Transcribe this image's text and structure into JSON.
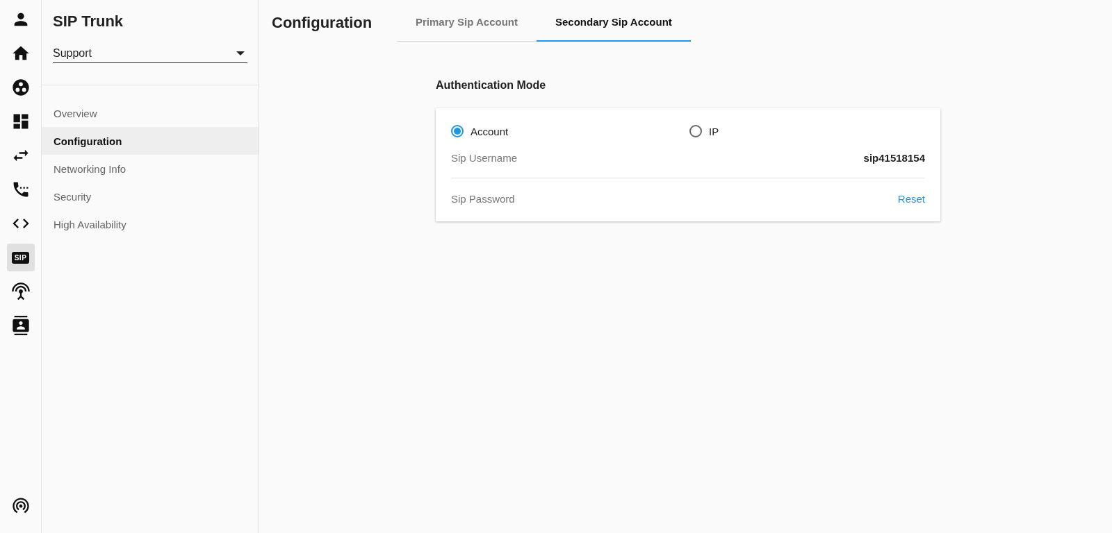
{
  "rail": {
    "items": [
      {
        "kind": "person",
        "selected": false
      },
      {
        "kind": "home",
        "selected": false
      },
      {
        "kind": "circles",
        "selected": false
      },
      {
        "kind": "dashboard",
        "selected": false
      },
      {
        "kind": "swap",
        "selected": false
      },
      {
        "kind": "phone",
        "selected": false
      },
      {
        "kind": "code",
        "selected": false
      },
      {
        "kind": "sip",
        "label": "SIP",
        "selected": true
      },
      {
        "kind": "antenna",
        "selected": false
      },
      {
        "kind": "contacts",
        "selected": false
      }
    ],
    "bottom": {
      "kind": "broadcast",
      "selected": false
    }
  },
  "sidebar": {
    "title": "SIP Trunk",
    "select": {
      "value": "Support"
    },
    "items": [
      {
        "label": "Overview",
        "selected": false
      },
      {
        "label": "Configuration",
        "selected": true
      },
      {
        "label": "Networking Info",
        "selected": false
      },
      {
        "label": "Security",
        "selected": false
      },
      {
        "label": "High Availability",
        "selected": false
      }
    ]
  },
  "main": {
    "title": "Configuration",
    "tabs": [
      {
        "label": "Primary Sip Account",
        "selected": false
      },
      {
        "label": "Secondary Sip Account",
        "selected": true
      }
    ],
    "section_title": "Authentication Mode",
    "modes": [
      {
        "label": "Account",
        "selected": true
      },
      {
        "label": "IP",
        "selected": false
      }
    ],
    "rows": [
      {
        "label": "Sip Username",
        "kind": "value",
        "value": "sip41518154"
      },
      {
        "label": "Sip Password",
        "kind": "link",
        "value": "Reset"
      }
    ]
  }
}
